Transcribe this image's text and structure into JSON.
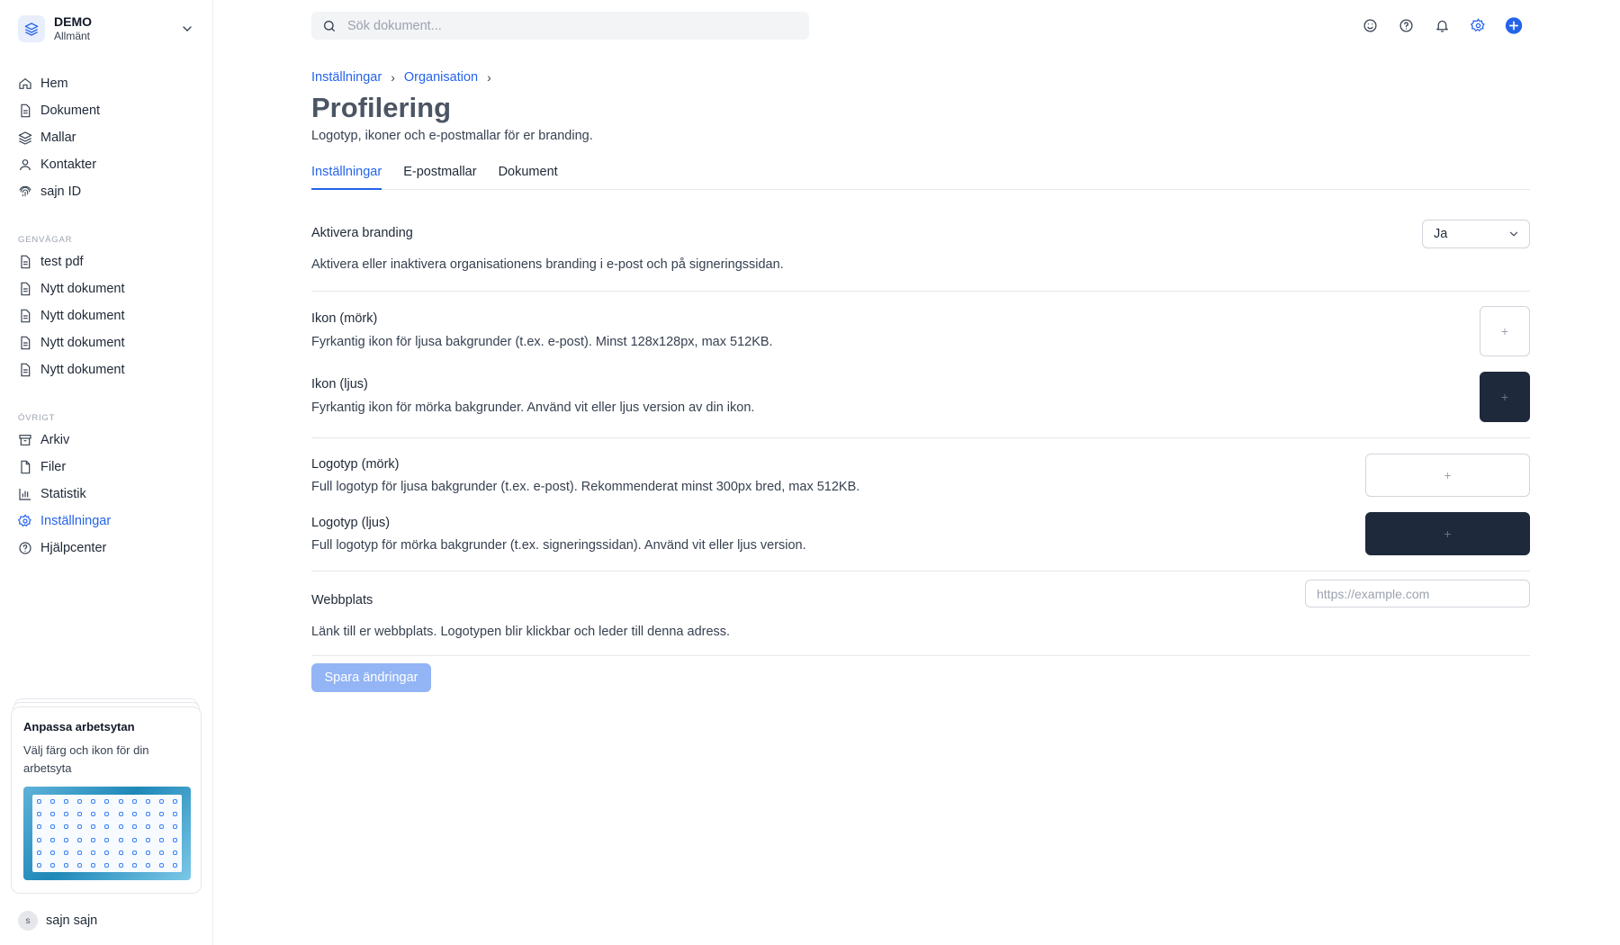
{
  "workspace": {
    "name": "DEMO",
    "subtitle": "Allmänt"
  },
  "nav_main": [
    {
      "label": "Hem",
      "icon": "home-icon"
    },
    {
      "label": "Dokument",
      "icon": "document-icon"
    },
    {
      "label": "Mallar",
      "icon": "layers-icon"
    },
    {
      "label": "Kontakter",
      "icon": "user-icon"
    },
    {
      "label": "sajn ID",
      "icon": "fingerprint-icon"
    }
  ],
  "shortcuts": {
    "heading": "GENVÄGAR",
    "items": [
      {
        "label": "test pdf"
      },
      {
        "label": "Nytt dokument"
      },
      {
        "label": "Nytt dokument"
      },
      {
        "label": "Nytt dokument"
      },
      {
        "label": "Nytt dokument"
      }
    ]
  },
  "other": {
    "heading": "ÖVRIGT",
    "items": [
      {
        "label": "Arkiv",
        "icon": "archive-icon"
      },
      {
        "label": "Filer",
        "icon": "file-icon"
      },
      {
        "label": "Statistik",
        "icon": "bar-chart-icon"
      },
      {
        "label": "Inställningar",
        "icon": "gear-icon",
        "active": true
      },
      {
        "label": "Hjälpcenter",
        "icon": "help-circle-icon"
      }
    ]
  },
  "promo": {
    "title": "Anpassa arbetsytan",
    "text": "Välj färg och ikon för din arbetsyta"
  },
  "user": {
    "initial": "s",
    "name": "sajn sajn"
  },
  "search": {
    "placeholder": "Sök dokument..."
  },
  "top_icons": [
    "smiley-icon",
    "help-icon",
    "bell-icon",
    "gear-icon",
    "plus-circle-icon"
  ],
  "breadcrumb": [
    "Inställningar",
    "Organisation"
  ],
  "page": {
    "title": "Profilering",
    "subtitle": "Logotyp, ikoner och e-postmallar för er branding."
  },
  "tabs": [
    {
      "label": "Inställningar",
      "active": true
    },
    {
      "label": "E-postmallar",
      "active": false
    },
    {
      "label": "Dokument",
      "active": false
    }
  ],
  "settings": {
    "branding": {
      "title": "Aktivera branding",
      "desc": "Aktivera eller inaktivera organisationens branding i e-post och på signeringssidan.",
      "value": "Ja"
    },
    "icon_dark": {
      "title": "Ikon (mörk)",
      "desc": "Fyrkantig ikon för ljusa bakgrunder (t.ex. e-post). Minst 128x128px, max 512KB."
    },
    "icon_light": {
      "title": "Ikon (ljus)",
      "desc": "Fyrkantig ikon för mörka bakgrunder. Använd vit eller ljus version av din ikon."
    },
    "logo_dark": {
      "title": "Logotyp (mörk)",
      "desc": "Full logotyp för ljusa bakgrunder (t.ex. e-post). Rekommenderat minst 300px bred, max 512KB."
    },
    "logo_light": {
      "title": "Logotyp (ljus)",
      "desc": "Full logotyp för mörka bakgrunder (t.ex. signeringssidan). Använd vit eller ljus version."
    },
    "website": {
      "title": "Webbplats",
      "desc": "Länk till er webbplats. Logotypen blir klickbar och leder till denna adress.",
      "placeholder": "https://example.com",
      "value": ""
    },
    "upload_symbol": "+"
  },
  "save_label": "Spara ändringar",
  "colors": {
    "accent": "#2563eb",
    "dark_tile": "#1e293b",
    "save_disabled": "#93b4f5"
  }
}
